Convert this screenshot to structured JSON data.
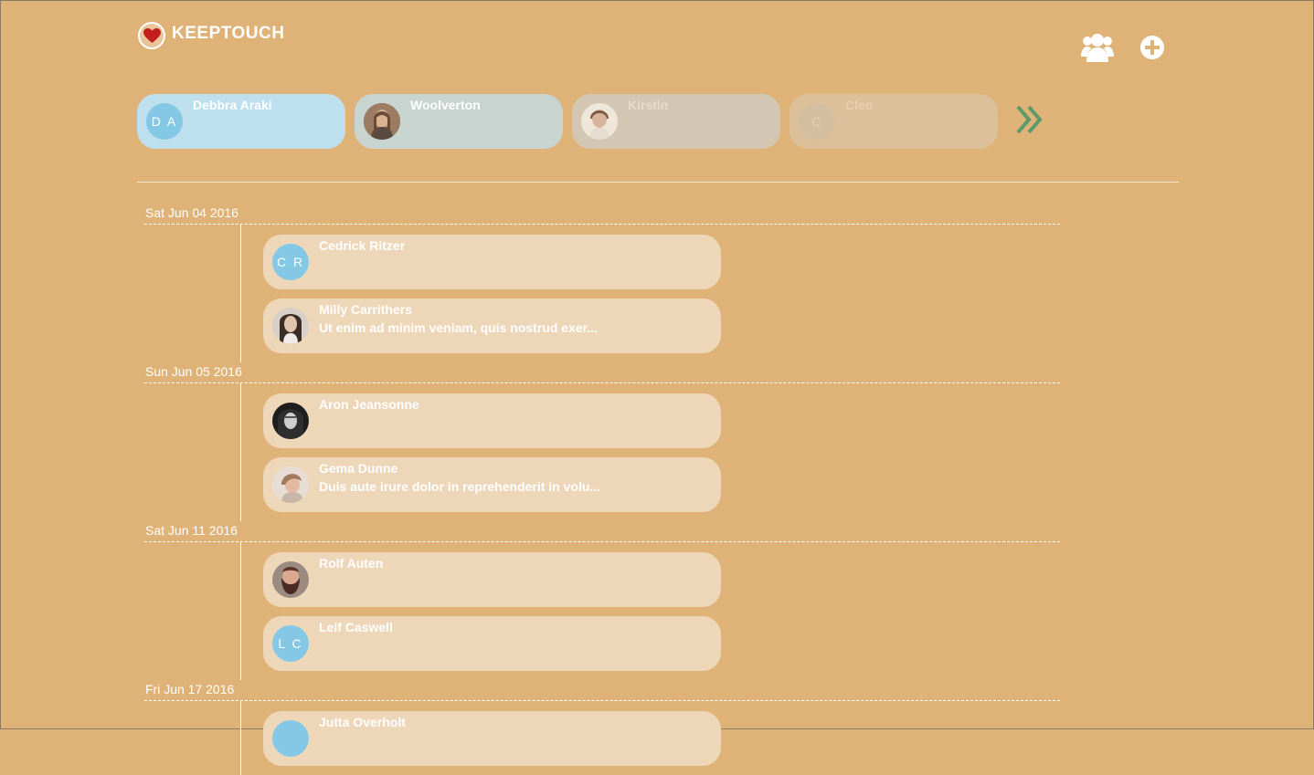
{
  "app": {
    "title": "KEEPTOUCH"
  },
  "header": {
    "icons": {
      "people": "people-icon",
      "add": "add-circle-icon"
    }
  },
  "friends": [
    {
      "name": "Debbra Araki",
      "initials": "D A",
      "photo": false,
      "bg": "#bee0ee",
      "avatar_bg": "#84c8e6",
      "text_color": "#ffffff",
      "opacity": 1
    },
    {
      "name": "Woolverton",
      "initials": "",
      "photo": true,
      "photo_tone": "#8a6a55",
      "bg": "#c7d4cf",
      "text_color": "#ffffff",
      "opacity": 1
    },
    {
      "name": "Kirstin",
      "initials": "",
      "photo": true,
      "photo_tone": "#c9a486",
      "bg": "#d3c7b3",
      "text_color": "#e7dccb",
      "opacity": 1
    },
    {
      "name": "Cleo",
      "initials": "C",
      "photo": false,
      "bg": "#dcc09a",
      "avatar_bg": "#d3bf9f",
      "text_color": "#e6cfb0",
      "opacity": 1
    }
  ],
  "timeline": [
    {
      "date": "Sat Jun 04 2016",
      "items": [
        {
          "name": "Cedrick Ritzer",
          "initials": "C R",
          "photo": false,
          "preview": ""
        },
        {
          "name": "Milly Carrithers",
          "initials": "",
          "photo": true,
          "photo_tone": "#6e5a50",
          "preview": "Ut enim ad minim veniam, quis nostrud exer..."
        }
      ]
    },
    {
      "date": "Sun Jun 05 2016",
      "items": [
        {
          "name": "Aron Jeansonne",
          "initials": "",
          "photo": true,
          "photo_tone": "#3a3a3a",
          "preview": ""
        },
        {
          "name": "Gema Dunne",
          "initials": "",
          "photo": true,
          "photo_tone": "#b48f7a",
          "preview": "Duis aute irure dolor in reprehenderit in volu..."
        }
      ]
    },
    {
      "date": "Sat Jun 11 2016",
      "items": [
        {
          "name": "Rolf Auten",
          "initials": "",
          "photo": true,
          "photo_tone": "#5a4038",
          "preview": ""
        },
        {
          "name": "Leif Caswell",
          "initials": "L C",
          "photo": false,
          "preview": ""
        }
      ]
    },
    {
      "date": "Fri Jun 17 2016",
      "items": [
        {
          "name": "Jutta Overholt",
          "initials": "",
          "photo": false,
          "preview": ""
        }
      ]
    }
  ]
}
